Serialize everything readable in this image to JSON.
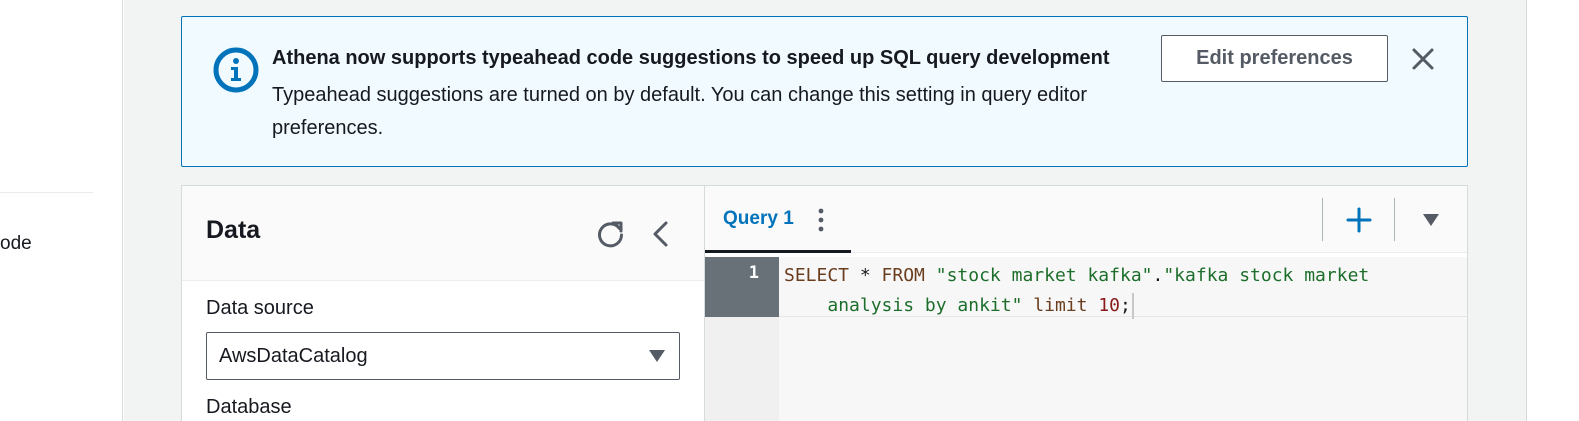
{
  "left_nav": {
    "partial_item": "ode"
  },
  "banner": {
    "icon": "info-icon",
    "title": "Athena now supports typeahead code suggestions to speed up SQL query development",
    "body": "Typeahead suggestions are turned on by default. You can change this setting in query editor preferences.",
    "edit_button": "Edit preferences",
    "close_icon": "close-icon",
    "accent_color": "#0073bb",
    "background_color": "#f1faff"
  },
  "data_panel": {
    "title": "Data",
    "refresh_icon": "refresh-icon",
    "collapse_icon": "chevron-left-icon",
    "data_source_label": "Data source",
    "data_source_value": "AwsDataCatalog",
    "database_label": "Database"
  },
  "editor": {
    "tab_label": "Query 1",
    "tab_menu_icon": "vertical-ellipsis-icon",
    "add_tab_icon": "plus-icon",
    "tab_dropdown_icon": "caret-down-icon",
    "line_number": "1",
    "code": {
      "kw1": "SELECT",
      "star": " * ",
      "kw2": "FROM",
      "str1": "\"stock market kafka\"",
      "dot": ".",
      "str2_line1": "\"kafka stock market",
      "str2_line2": "analysis by ankit\"",
      "kw3": "limit",
      "num": "10",
      "semi": ";"
    }
  }
}
